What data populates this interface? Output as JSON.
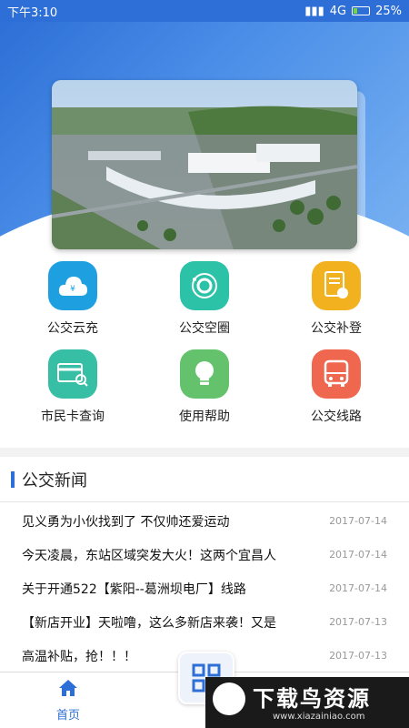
{
  "status_bar": {
    "time": "下午3:10",
    "network": "4G",
    "battery": "25%"
  },
  "hero": {
    "image_alt": "bus station aerial view"
  },
  "services": [
    {
      "label": "公交云充",
      "icon": "cloud-yuan-icon",
      "color": "#1ea0e0"
    },
    {
      "label": "公交空圈",
      "icon": "circle-target-icon",
      "color": "#2bc2a8"
    },
    {
      "label": "公交补登",
      "icon": "document-edit-icon",
      "color": "#f2b21f"
    },
    {
      "label": "市民卡查询",
      "icon": "card-search-icon",
      "color": "#37bfa6"
    },
    {
      "label": "使用帮助",
      "icon": "lightbulb-icon",
      "color": "#63c26b"
    },
    {
      "label": "公交线路",
      "icon": "bus-icon",
      "color": "#f0674f"
    }
  ],
  "news": {
    "title": "公交新闻",
    "items": [
      {
        "title": "见义勇为小伙找到了 不仅帅还爱运动",
        "date": "2017-07-14"
      },
      {
        "title": "今天凌晨，东站区域突发大火！这两个宜昌人",
        "date": "2017-07-14"
      },
      {
        "title": "关于开通522【紫阳--葛洲坝电厂】线路",
        "date": "2017-07-14"
      },
      {
        "title": "【新店开业】天啦噜，这么多新店来袭！又是",
        "date": "2017-07-13"
      },
      {
        "title": "高温补贴，抢！！！",
        "date": "2017-07-13"
      }
    ]
  },
  "tabbar": {
    "home_label": "首页"
  },
  "watermark": {
    "brand": "下载鸟资源",
    "url": "www.xiazainiao.com"
  }
}
